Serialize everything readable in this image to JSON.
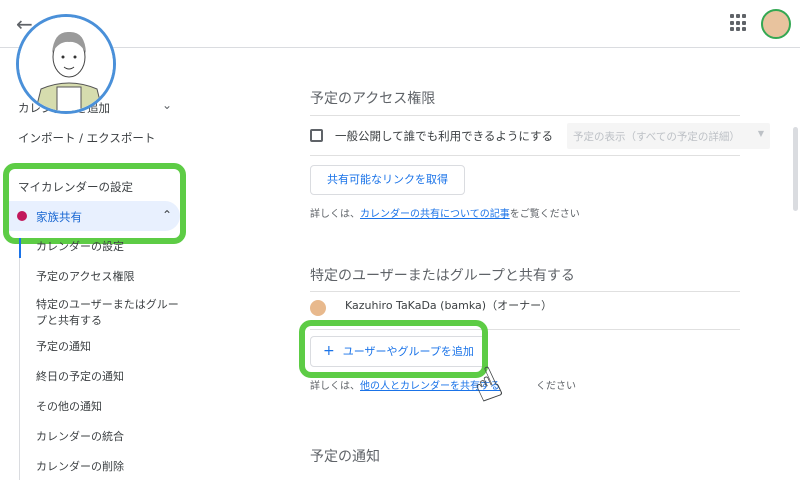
{
  "header": {
    "back_icon": "arrow-left-icon",
    "apps_icon": "grid-icon"
  },
  "sidebar": {
    "add_calendar": "カレンダーを追加",
    "import_export": "インポート / エクスポート",
    "my_calendars": "マイカレンダーの設定",
    "calendar_name": "家族共有",
    "calendar_color": "#c2185b",
    "subitems": [
      "カレンダーの設定",
      "予定のアクセス権限",
      "特定のユーザーまたはグループと共有する",
      "予定の通知",
      "終日の予定の通知",
      "その他の通知",
      "カレンダーの統合",
      "カレンダーの削除"
    ]
  },
  "access": {
    "title": "予定のアクセス権限",
    "public_label": "一般公開して誰でも利用できるようにする",
    "visibility_select": "予定の表示（すべての予定の詳細）",
    "link_button": "共有可能なリンクを取得",
    "help_prefix": "詳しくは、",
    "help_link": "カレンダーの共有についての記事",
    "help_suffix": "をご覧ください"
  },
  "share": {
    "title": "特定のユーザーまたはグループと共有する",
    "owner": "Kazuhiro TaKaDa (bamka)（オーナー）",
    "add_button": "ユーザーやグループを追加",
    "help_prefix": "詳しくは、",
    "help_link": "他の人とカレンダーを共有する",
    "help_suffix": "ください"
  },
  "notify": {
    "title": "予定の通知"
  },
  "highlight_color": "#5dcc45"
}
